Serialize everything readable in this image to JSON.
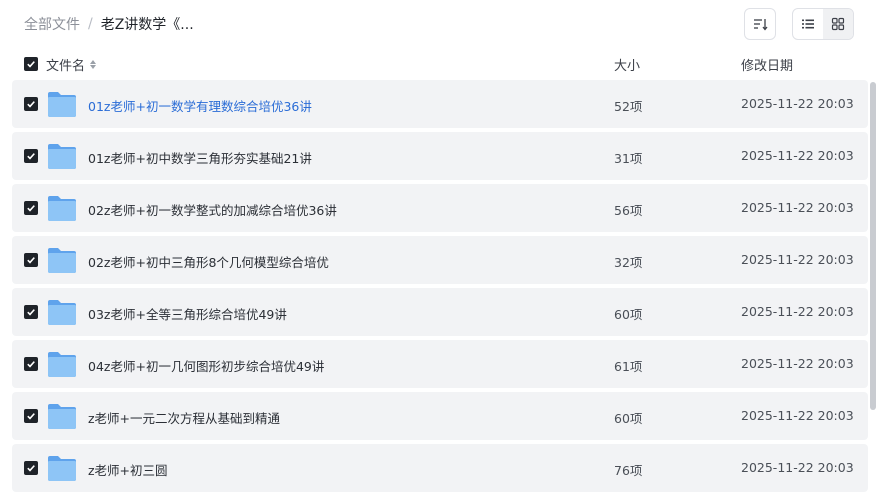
{
  "breadcrumb": {
    "root": "全部文件",
    "separator": "/",
    "current": "老Z讲数学《..."
  },
  "toolbar": {
    "sort_icon": "sort-desc-icon",
    "list_view_icon": "list-view-icon",
    "grid_view_icon": "grid-view-icon",
    "active_view": "list"
  },
  "table": {
    "columns": {
      "name": "文件名",
      "size": "大小",
      "date": "修改日期"
    },
    "rows": [
      {
        "name": "01z老师+初一数学有理数综合培优36讲",
        "size": "52项",
        "date": "2025-11-22 20:03",
        "checked": true,
        "highlighted": true
      },
      {
        "name": "01z老师+初中数学三角形夯实基础21讲",
        "size": "31项",
        "date": "2025-11-22 20:03",
        "checked": true
      },
      {
        "name": "02z老师+初一数学整式的加减综合培优36讲",
        "size": "56项",
        "date": "2025-11-22 20:03",
        "checked": true
      },
      {
        "name": "02z老师+初中三角形8个几何模型综合培优",
        "size": "32项",
        "date": "2025-11-22 20:03",
        "checked": true
      },
      {
        "name": "03z老师+全等三角形综合培优49讲",
        "size": "60项",
        "date": "2025-11-22 20:03",
        "checked": true
      },
      {
        "name": "04z老师+初一几何图形初步综合培优49讲",
        "size": "61项",
        "date": "2025-11-22 20:03",
        "checked": true
      },
      {
        "name": "z老师+一元二次方程从基础到精通",
        "size": "60项",
        "date": "2025-11-22 20:03",
        "checked": true
      },
      {
        "name": "z老师+初三圆",
        "size": "76项",
        "date": "2025-11-22 20:03",
        "checked": true
      }
    ]
  },
  "colors": {
    "link": "#2a6cd6",
    "row_bg": "#f2f3f5",
    "folder": "#7cb8f2"
  }
}
